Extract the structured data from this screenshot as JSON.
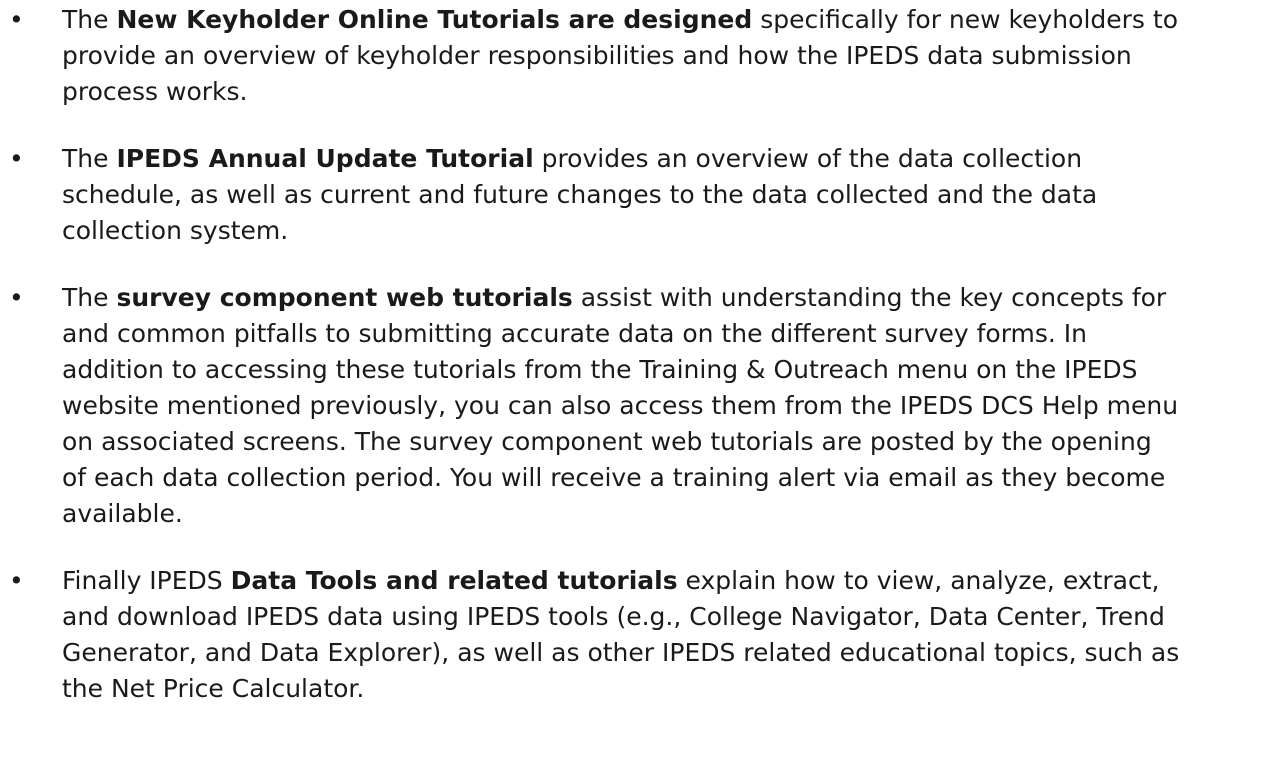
{
  "bullets": [
    {
      "pre": "The ",
      "bold": "New Keyholder Online Tutorials are designed",
      "post": " specifically for new keyholders to provide an overview of keyholder responsibilities and how the IPEDS data submission process works."
    },
    {
      "pre": "The ",
      "bold": "IPEDS Annual Update Tutorial",
      "post": " provides an overview of the data collection schedule, as well as current and future changes to the data collected and the data collection system."
    },
    {
      "pre": "The ",
      "bold": "survey component web tutorials",
      "post": " assist with understanding the key concepts for and common pitfalls to submitting accurate data on the different survey forms. In addition to accessing these tutorials from the Training & Outreach menu on the IPEDS website mentioned previously, you can also access them from the IPEDS DCS Help menu on associated screens. The survey component web tutorials are posted by the opening of each data collection period. You will receive a training alert via email as they become available."
    },
    {
      "pre": "Finally IPEDS ",
      "bold": "Data Tools and related tutorials",
      "post": " explain how to view, analyze, extract, and download IPEDS data using IPEDS tools (e.g., College Navigator, Data Center, Trend Generator, and Data Explorer), as well as other IPEDS related educational topics, such as the Net Price Calculator."
    }
  ],
  "bullet_symbol": "•"
}
